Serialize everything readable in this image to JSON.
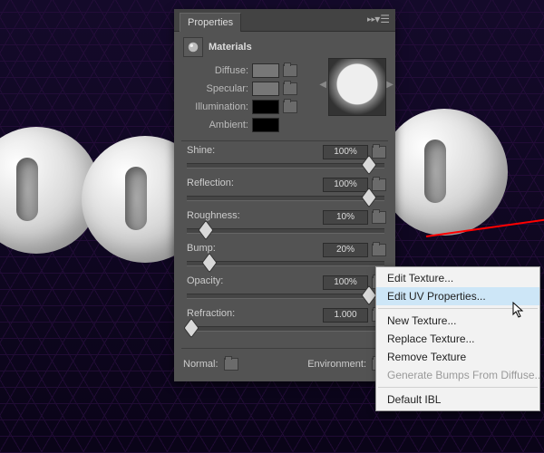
{
  "panel": {
    "title": "Properties",
    "section": "Materials",
    "preview_nav": {
      "left": "◀",
      "right": "▶"
    },
    "colors": {
      "diffuse_label": "Diffuse:",
      "specular_label": "Specular:",
      "illumination_label": "Illumination:",
      "ambient_label": "Ambient:"
    },
    "sliders": {
      "shine": {
        "label": "Shine:",
        "value": "100%",
        "pos": 100
      },
      "reflection": {
        "label": "Reflection:",
        "value": "100%",
        "pos": 100
      },
      "roughness": {
        "label": "Roughness:",
        "value": "10%",
        "pos": 10
      },
      "bump": {
        "label": "Bump:",
        "value": "20%",
        "pos": 12
      },
      "opacity": {
        "label": "Opacity:",
        "value": "100%",
        "pos": 100
      },
      "refraction": {
        "label": "Refraction:",
        "value": "1.000",
        "pos": 2
      }
    },
    "normal_label": "Normal:",
    "env_label": "Environment:"
  },
  "menu": {
    "edit_texture": "Edit Texture...",
    "edit_uv": "Edit UV Properties...",
    "new_texture": "New Texture...",
    "replace_texture": "Replace Texture...",
    "remove_texture": "Remove Texture",
    "gen_bumps": "Generate Bumps From Diffuse..",
    "default_ibl": "Default IBL"
  }
}
